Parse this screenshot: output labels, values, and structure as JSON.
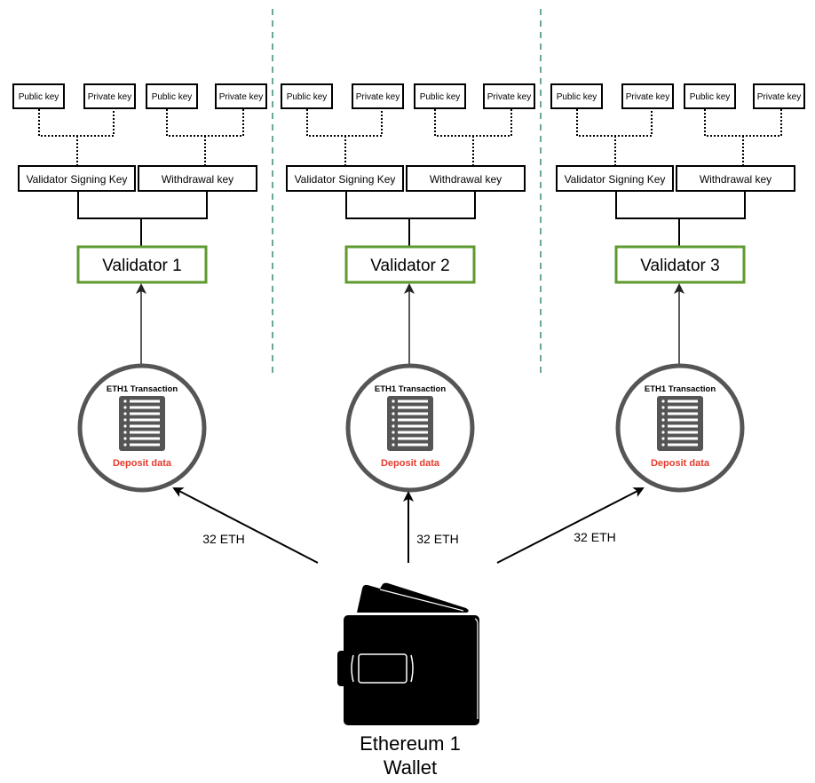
{
  "diagram": {
    "validators": [
      {
        "name": "Validator 1",
        "signing_key": "Validator Signing Key",
        "withdrawal_key": "Withdrawal key",
        "signing_pair": [
          "Public key",
          "Private key"
        ],
        "withdrawal_pair": [
          "Public key",
          "Private key"
        ],
        "transaction_title": "ETH1 Transaction",
        "transaction_caption": "Deposit data",
        "deposit_amount": "32 ETH"
      },
      {
        "name": "Validator 2",
        "signing_key": "Validator Signing Key",
        "withdrawal_key": "Withdrawal key",
        "signing_pair": [
          "Public key",
          "Private key"
        ],
        "withdrawal_pair": [
          "Public key",
          "Private key"
        ],
        "transaction_title": "ETH1 Transaction",
        "transaction_caption": "Deposit data",
        "deposit_amount": "32 ETH"
      },
      {
        "name": "Validator 3",
        "signing_key": "Validator Signing Key",
        "withdrawal_key": "Withdrawal key",
        "signing_pair": [
          "Public key",
          "Private key"
        ],
        "withdrawal_pair": [
          "Public key",
          "Private key"
        ],
        "transaction_title": "ETH1 Transaction",
        "transaction_caption": "Deposit data",
        "deposit_amount": "32 ETH"
      }
    ],
    "wallet": {
      "line1": "Ethereum 1",
      "line2": "Wallet"
    }
  },
  "colors": {
    "validator_border": "#5e9a2f",
    "divider": "#6aa89a",
    "circle": "#555555",
    "deposit_text": "#e53b2c"
  }
}
